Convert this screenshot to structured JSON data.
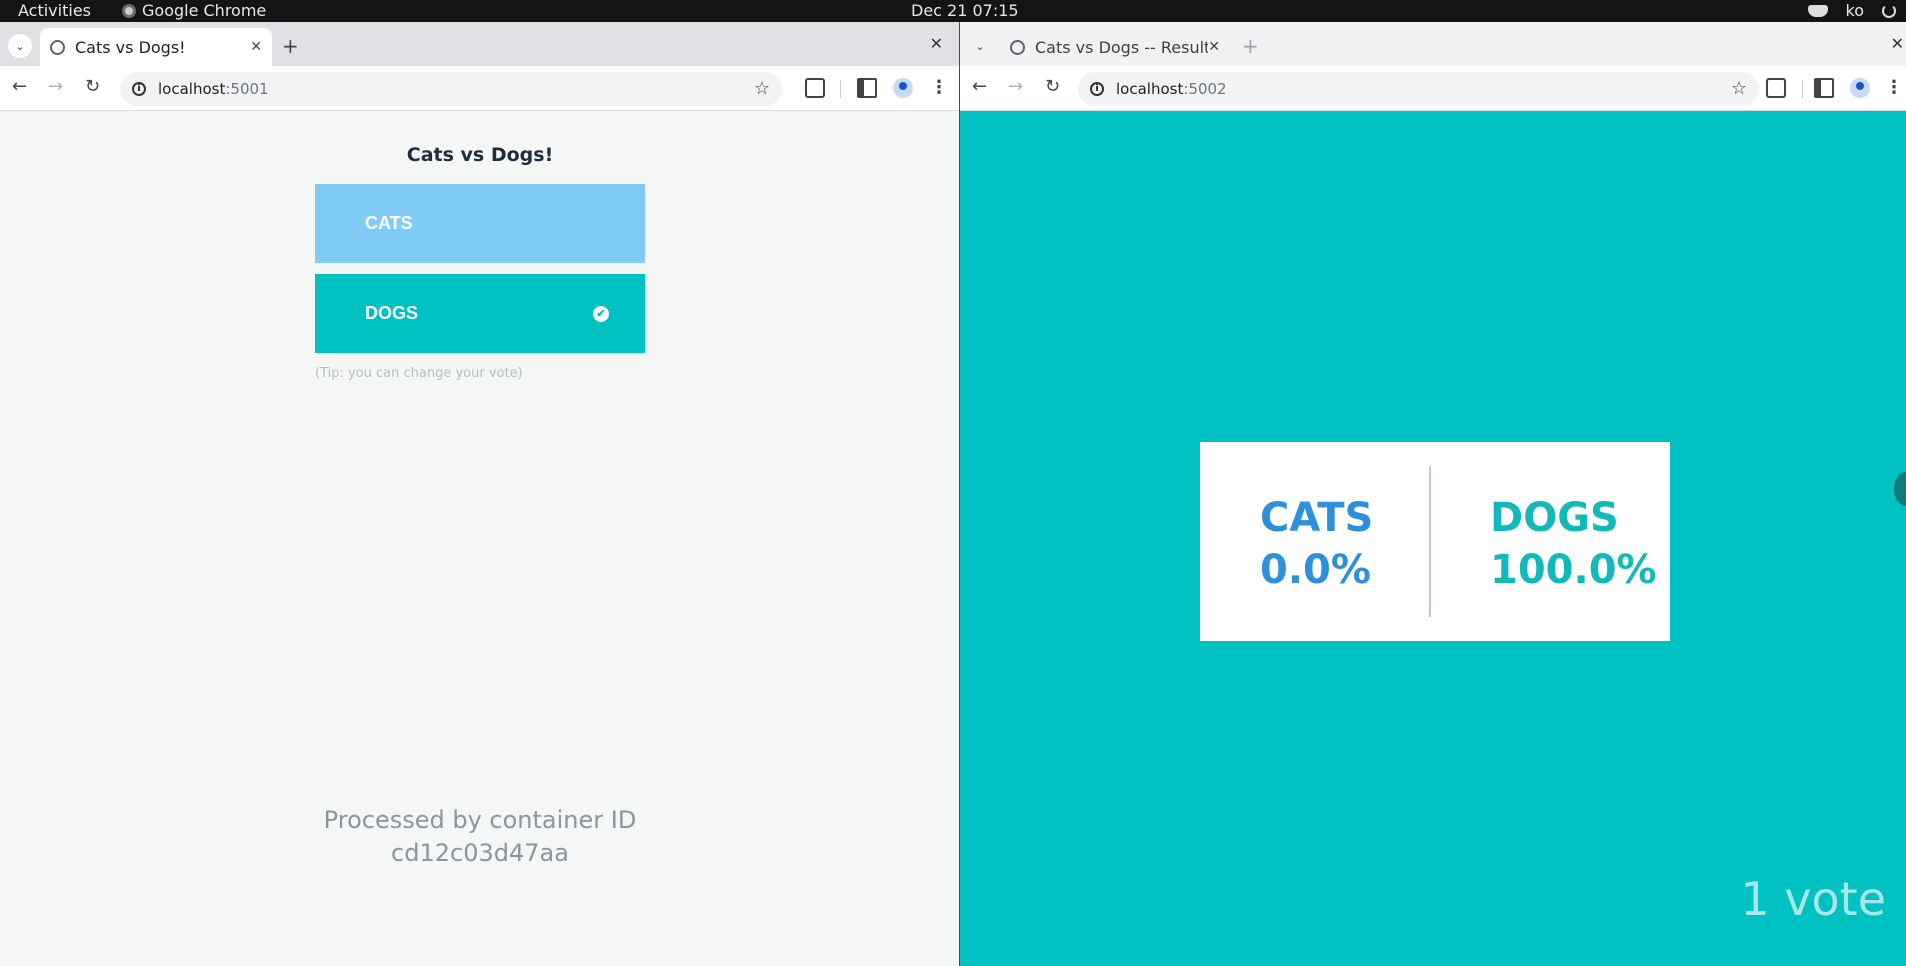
{
  "topbar": {
    "activities": "Activities",
    "app_name": "Google Chrome",
    "clock": "Dec 21  07:15",
    "user": "ko"
  },
  "vote_window": {
    "tab_title": "Cats vs Dogs!",
    "url_host": "localhost",
    "url_port": ":5001",
    "page": {
      "title": "Cats vs Dogs!",
      "option_a": "CATS",
      "option_b": "DOGS",
      "selected": "DOGS",
      "tip": "(Tip: you can change your vote)",
      "processed_line1": "Processed by container ID",
      "processed_line2": "cd12c03d47aa"
    }
  },
  "result_window": {
    "tab_title": "Cats vs Dogs -- Result",
    "url_host": "localhost",
    "url_port": ":5002",
    "page": {
      "cats_label": "CATS",
      "cats_percent": "0.0%",
      "dogs_label": "DOGS",
      "dogs_percent": "100.0%",
      "vote_count": "1 vote"
    }
  },
  "colors": {
    "cats_button": "#7fcbf6",
    "dogs_button": "#00c1c1",
    "result_background": "#00c1c1",
    "cats_text": "#2e8fdd",
    "dogs_text": "#13b9b9"
  }
}
